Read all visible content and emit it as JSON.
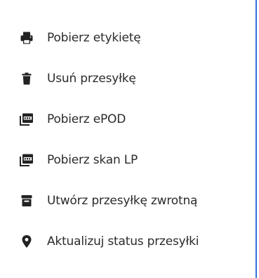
{
  "menu": {
    "items": [
      {
        "label": "Pobierz etykietę",
        "icon": "print-icon"
      },
      {
        "label": "Usuń przesyłkę",
        "icon": "trash-icon"
      },
      {
        "label": "Pobierz ePOD",
        "icon": "pdf-file-icon"
      },
      {
        "label": "Pobierz skan LP",
        "icon": "pdf-file-icon"
      },
      {
        "label": "Utwórz przesyłkę zwrotną",
        "icon": "archive-box-icon"
      },
      {
        "label": "Aktualizuj status przesyłki",
        "icon": "map-marker-icon"
      }
    ]
  },
  "colors": {
    "text": "#2b2b2b",
    "icon": "#222222",
    "panel_border": "#2f73d8",
    "background": "#ffffff"
  }
}
